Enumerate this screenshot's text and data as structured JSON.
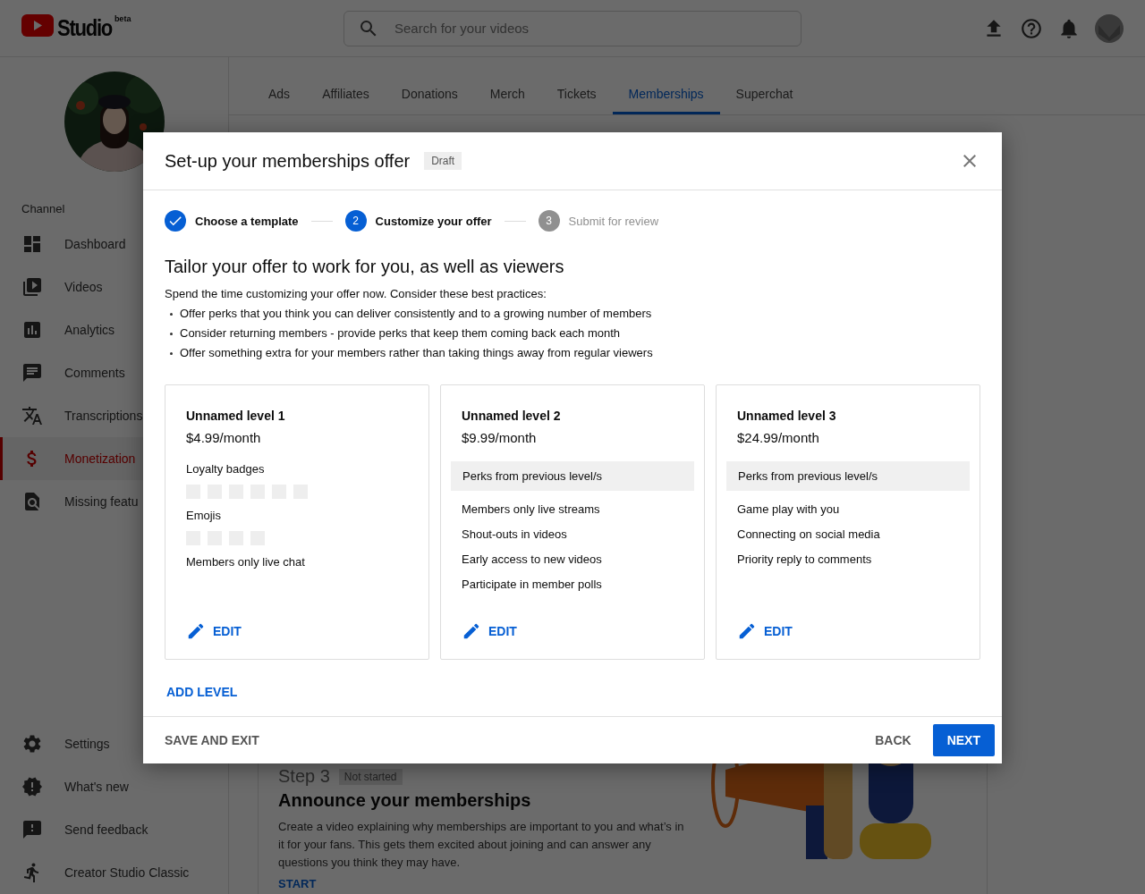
{
  "header": {
    "logo_text": "Studio",
    "logo_badge": "beta",
    "search": {
      "placeholder": "Search for your videos"
    }
  },
  "sidebar": {
    "channel_label": "Channel",
    "items": [
      {
        "label": "Dashboard",
        "selected": false
      },
      {
        "label": "Videos",
        "selected": false
      },
      {
        "label": "Analytics",
        "selected": false
      },
      {
        "label": "Comments",
        "selected": false
      },
      {
        "label": "Transcriptions",
        "selected": false
      },
      {
        "label": "Monetization",
        "selected": true
      },
      {
        "label": "Missing featu",
        "selected": false
      }
    ],
    "bottom_items": [
      {
        "label": "Settings"
      },
      {
        "label": "What's new"
      },
      {
        "label": "Send feedback"
      },
      {
        "label": "Creator Studio Classic"
      }
    ]
  },
  "tabs": [
    {
      "label": "Ads",
      "selected": false
    },
    {
      "label": "Affiliates",
      "selected": false
    },
    {
      "label": "Donations",
      "selected": false
    },
    {
      "label": "Merch",
      "selected": false
    },
    {
      "label": "Tickets",
      "selected": false
    },
    {
      "label": "Memberships",
      "selected": true
    },
    {
      "label": "Superchat",
      "selected": false
    }
  ],
  "background_card": {
    "step": "Step 3",
    "status": "Not started",
    "title": "Announce your memberships",
    "description": "Create a video explaining why memberships are important to you and what’s in it for your fans. This gets them excited about joining and can answer any questions you think they may have.",
    "action": "START"
  },
  "dialog": {
    "title": "Set-up your memberships offer",
    "badge": "Draft",
    "steps": [
      {
        "label": "Choose a template",
        "completed": true,
        "disabled": false
      },
      {
        "number": "2",
        "label": "Customize your offer",
        "completed": false,
        "disabled": false
      },
      {
        "number": "3",
        "label": "Submit for review",
        "completed": false,
        "disabled": true
      }
    ],
    "heading": "Tailor your offer to work for you, as well as viewers",
    "intro": "Spend the time customizing your offer now. Consider these best practices:",
    "bullets": [
      "Offer perks that you think you can deliver consistently and to a growing number of members",
      "Consider returning members - provide perks that keep them coming back each month",
      "Offer something extra for your members rather than taking things away from regular viewers"
    ],
    "levels": [
      {
        "name": "Unnamed level 1",
        "price": "$4.99/month",
        "perks": [
          {
            "label": "Loyalty badges",
            "kind": "badges"
          },
          {
            "label": "Emojis",
            "kind": "emojis"
          },
          {
            "label": "Members only live chat",
            "kind": "text"
          }
        ],
        "edit": "EDIT"
      },
      {
        "name": "Unnamed level 2",
        "price": "$9.99/month",
        "inherited": "Perks from previous level/s",
        "perks": [
          {
            "label": "Members only live streams",
            "kind": "text"
          },
          {
            "label": "Shout-outs in videos",
            "kind": "text"
          },
          {
            "label": "Early access to new videos",
            "kind": "text"
          },
          {
            "label": "Participate in member polls",
            "kind": "text"
          }
        ],
        "edit": "EDIT"
      },
      {
        "name": "Unnamed level 3",
        "price": "$24.99/month",
        "inherited": "Perks from previous level/s",
        "perks": [
          {
            "label": "Game play with you",
            "kind": "text"
          },
          {
            "label": "Connecting on social media",
            "kind": "text"
          },
          {
            "label": "Priority reply to comments",
            "kind": "text"
          }
        ],
        "edit": "EDIT"
      }
    ],
    "add_level": "ADD LEVEL",
    "footer": {
      "save": "SAVE AND EXIT",
      "back": "BACK",
      "next": "NEXT"
    }
  }
}
